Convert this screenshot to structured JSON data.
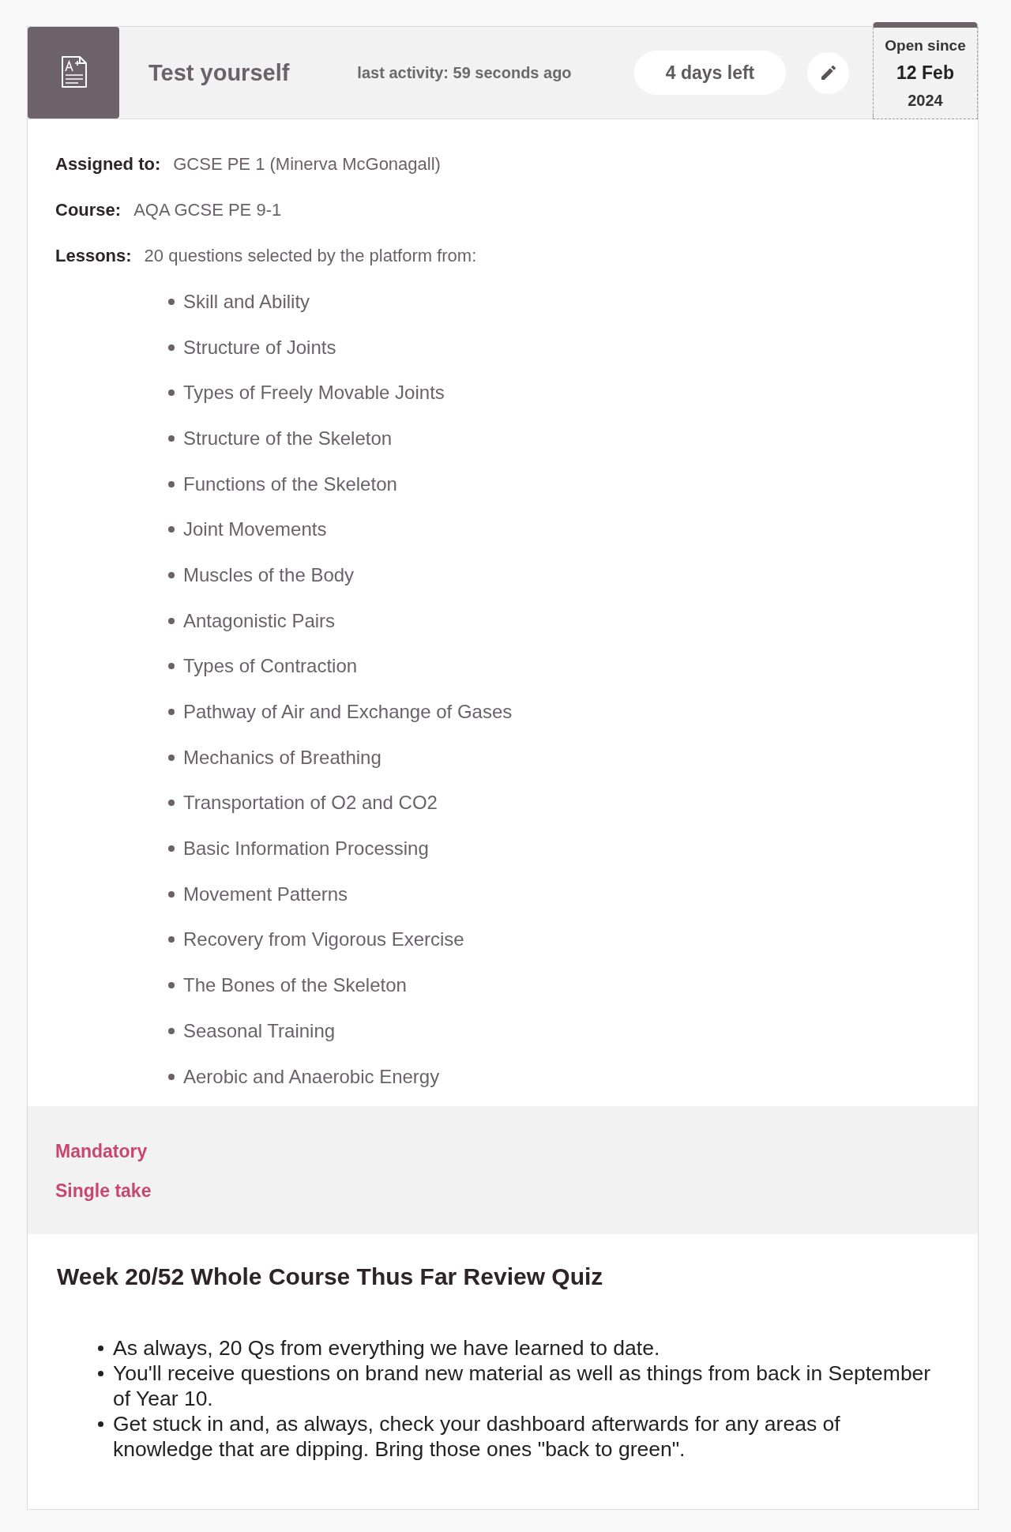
{
  "header": {
    "title": "Test yourself",
    "last_activity": "last activity: 59 seconds ago",
    "time_left": "4 days left",
    "open_since": {
      "label": "Open since",
      "date": "12 Feb",
      "year": "2024"
    }
  },
  "details": [
    {
      "label": "Assigned to:",
      "value": "GCSE PE 1 (Minerva McGonagall)"
    },
    {
      "label": "Course:",
      "value": "AQA GCSE PE 9-1"
    },
    {
      "label": "Lessons:",
      "value": "20 questions selected by the platform from:"
    }
  ],
  "lesson_topics": [
    "Skill and Ability",
    "Structure of Joints",
    "Types of Freely Movable Joints",
    "Structure of the Skeleton",
    "Functions of the Skeleton",
    "Joint Movements",
    "Muscles of the Body",
    "Antagonistic Pairs",
    "Types of Contraction",
    "Pathway of Air and Exchange of Gases",
    "Mechanics of Breathing",
    "Transportation of O2 and CO2",
    "Basic Information Processing",
    "Movement Patterns",
    "Recovery from Vigorous Exercise",
    "The Bones of the Skeleton",
    "Seasonal Training",
    "Aerobic and Anaerobic Energy"
  ],
  "tags": [
    "Mandatory",
    "Single take"
  ],
  "description": {
    "title": "Week 20/52 Whole Course Thus Far Review Quiz",
    "points": [
      "As always, 20 Qs from everything we have learned to date.",
      "You'll receive questions on brand new material as well as things from back in September of Year 10.",
      "Get stuck in and, as always, check your dashboard afterwards for any areas of knowledge that are dipping. Bring those ones \"back to green\"."
    ]
  }
}
